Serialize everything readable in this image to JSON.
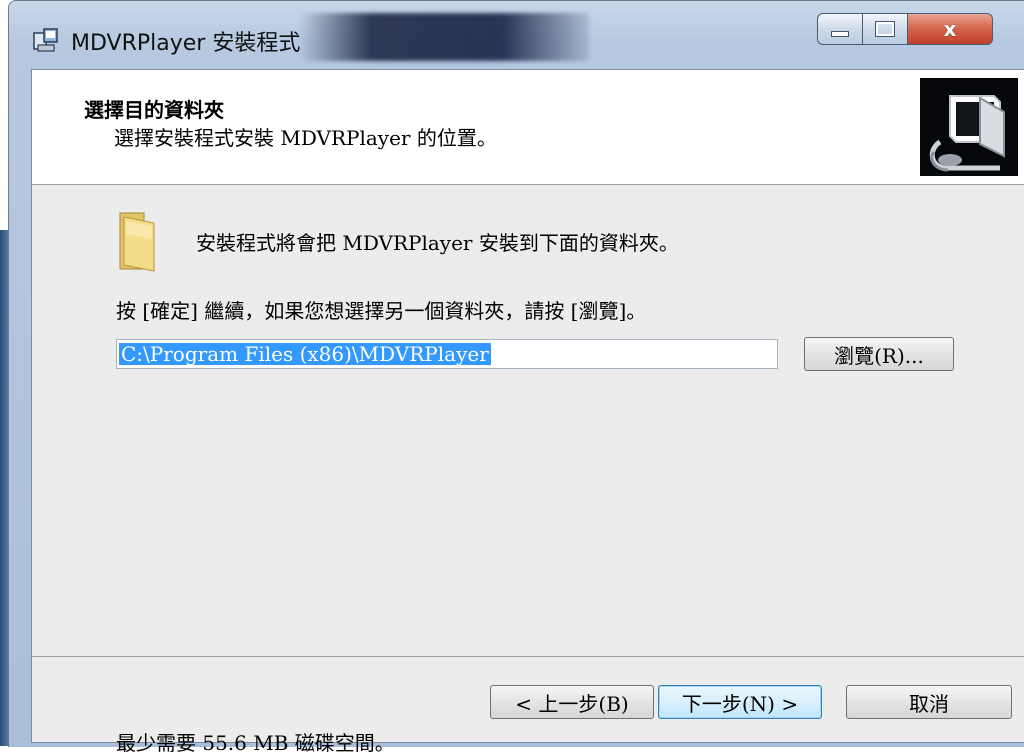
{
  "window": {
    "title": "MDVRPlayer 安裝程式",
    "close_glyph": "x"
  },
  "header": {
    "title": "選擇目的資料夾",
    "subtitle": "選擇安裝程式安裝 MDVRPlayer 的位置。"
  },
  "body": {
    "folder_message": "安裝程式將會把 MDVRPlayer 安裝到下面的資料夾。",
    "instruction": "按 [確定] 繼續，如果您想選擇另一個資料夾，請按 [瀏覽]。",
    "path_value": "C:\\Program Files (x86)\\MDVRPlayer",
    "browse_label": "瀏覽(R)...",
    "space_required": "最少需要 55.6 MB 磁碟空間。"
  },
  "footer": {
    "back_label": "< 上一步(B)",
    "next_label": "下一步(N) >",
    "cancel_label": "取消"
  },
  "icons": {
    "app": "installer-icon",
    "header_image": "computer-install-icon",
    "folder": "folder-icon"
  },
  "colors": {
    "selection": "#3399ff",
    "client_background": "#ececec"
  }
}
